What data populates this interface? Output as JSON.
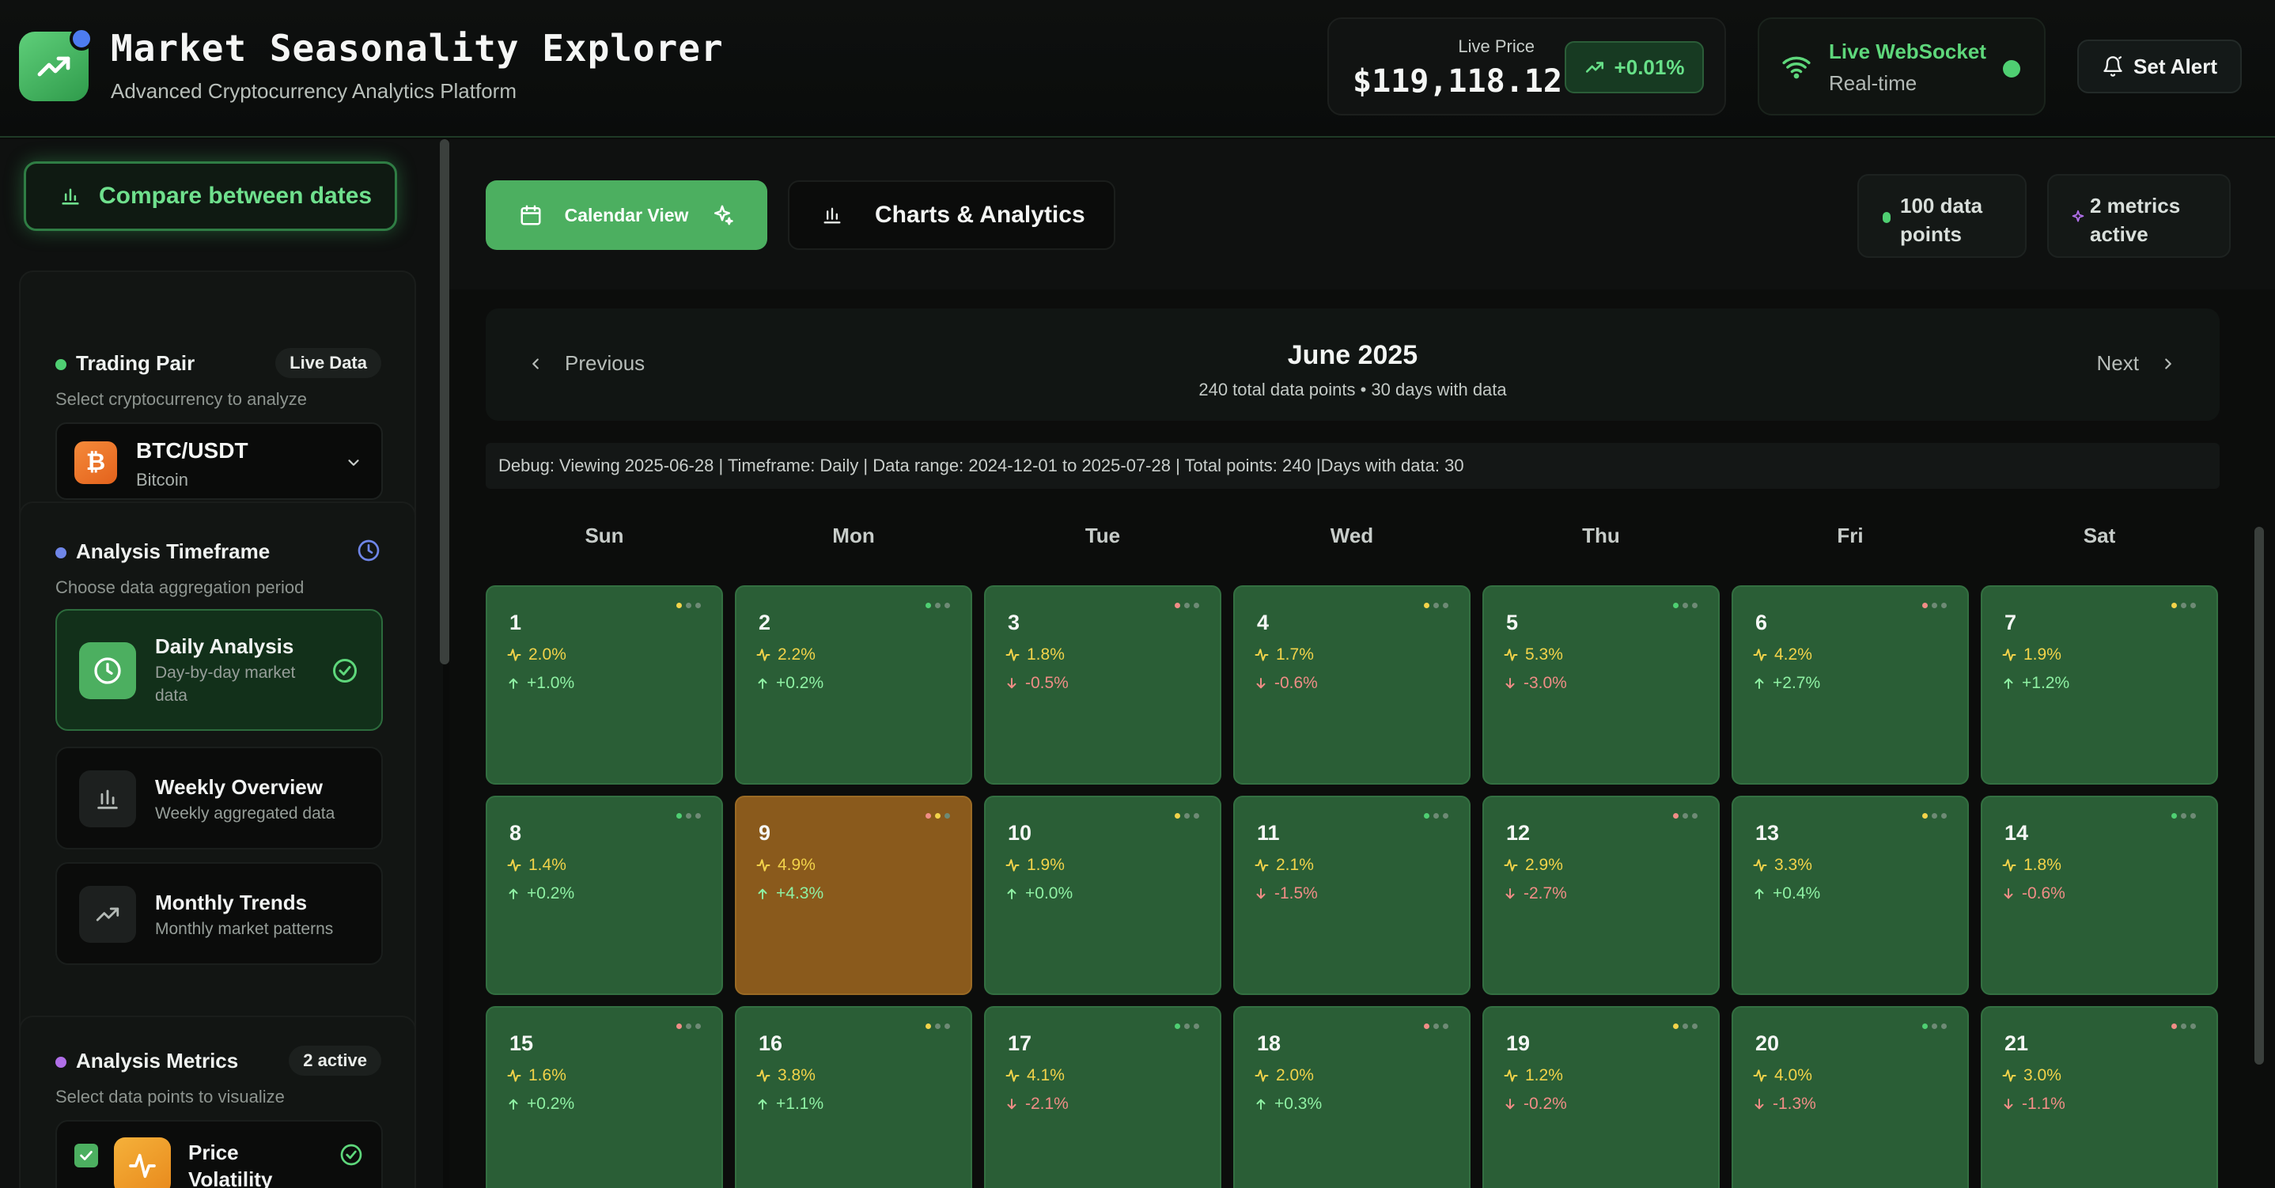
{
  "app": {
    "title": "Market Seasonality Explorer",
    "subtitle": "Advanced Cryptocurrency Analytics Platform"
  },
  "price": {
    "label": "Live Price",
    "value": "$119,118.12",
    "change": "+0.01%"
  },
  "websocket": {
    "title": "Live WebSocket",
    "subtitle": "Real-time"
  },
  "alert_button": "Set Alert",
  "sidebar": {
    "compare_button": "Compare between dates",
    "trading_pair": {
      "title": "Trading Pair",
      "badge": "Live Data",
      "description": "Select cryptocurrency to analyze",
      "selected_symbol": "BTC/USDT",
      "selected_name": "Bitcoin",
      "badge_glyph": "₿"
    },
    "timeframe": {
      "title": "Analysis Timeframe",
      "description": "Choose data aggregation period",
      "options": [
        {
          "name": "Daily Analysis",
          "desc": "Day-by-day market data"
        },
        {
          "name": "Weekly Overview",
          "desc": "Weekly aggregated data"
        },
        {
          "name": "Monthly Trends",
          "desc": "Monthly market patterns"
        }
      ]
    },
    "metrics": {
      "title": "Analysis Metrics",
      "badge": "2 active",
      "description": "Select data points to visualize",
      "first_item": "Price Volatility"
    }
  },
  "view_tabs": {
    "calendar": "Calendar View",
    "charts": "Charts & Analytics"
  },
  "stats": {
    "points": "100 data points",
    "metrics": "2 metrics active"
  },
  "month_nav": {
    "previous": "Previous",
    "next": "Next",
    "title": "June 2025",
    "subtitle": "240 total data points • 30 days with data"
  },
  "debug_text": "Debug: Viewing 2025-06-28 | Timeframe: Daily | Data range: 2024-12-01 to 2025-07-28 | Total points: 240 |Days with data: 30",
  "weekdays": [
    "Sun",
    "Mon",
    "Tue",
    "Wed",
    "Thu",
    "Fri",
    "Sat"
  ],
  "calendar_days": [
    {
      "day": "1",
      "vol": "2.0%",
      "chg": "+1.0%",
      "dir": "up"
    },
    {
      "day": "2",
      "vol": "2.2%",
      "chg": "+0.2%",
      "dir": "up"
    },
    {
      "day": "3",
      "vol": "1.8%",
      "chg": "-0.5%",
      "dir": "down"
    },
    {
      "day": "4",
      "vol": "1.7%",
      "chg": "-0.6%",
      "dir": "down"
    },
    {
      "day": "5",
      "vol": "5.3%",
      "chg": "-3.0%",
      "dir": "down"
    },
    {
      "day": "6",
      "vol": "4.2%",
      "chg": "+2.7%",
      "dir": "up"
    },
    {
      "day": "7",
      "vol": "1.9%",
      "chg": "+1.2%",
      "dir": "up"
    },
    {
      "day": "8",
      "vol": "1.4%",
      "chg": "+0.2%",
      "dir": "up"
    },
    {
      "day": "9",
      "vol": "4.9%",
      "chg": "+4.3%",
      "dir": "up",
      "hot": true
    },
    {
      "day": "10",
      "vol": "1.9%",
      "chg": "+0.0%",
      "dir": "up"
    },
    {
      "day": "11",
      "vol": "2.1%",
      "chg": "-1.5%",
      "dir": "down"
    },
    {
      "day": "12",
      "vol": "2.9%",
      "chg": "-2.7%",
      "dir": "down"
    },
    {
      "day": "13",
      "vol": "3.3%",
      "chg": "+0.4%",
      "dir": "up"
    },
    {
      "day": "14",
      "vol": "1.8%",
      "chg": "-0.6%",
      "dir": "down"
    },
    {
      "day": "15",
      "vol": "1.6%",
      "chg": "+0.2%",
      "dir": "up"
    },
    {
      "day": "16",
      "vol": "3.8%",
      "chg": "+1.1%",
      "dir": "up"
    },
    {
      "day": "17",
      "vol": "4.1%",
      "chg": "-2.1%",
      "dir": "down"
    },
    {
      "day": "18",
      "vol": "2.0%",
      "chg": "+0.3%",
      "dir": "up"
    },
    {
      "day": "19",
      "vol": "1.2%",
      "chg": "-0.2%",
      "dir": "down"
    },
    {
      "day": "20",
      "vol": "4.0%",
      "chg": "-1.3%",
      "dir": "down"
    },
    {
      "day": "21",
      "vol": "3.0%",
      "chg": "-1.1%",
      "dir": "down"
    }
  ],
  "colors": {
    "accent": "#4caf60",
    "up": "#8ef0a3",
    "down": "#f08d86",
    "volatility": "#f2d34a",
    "cell": "#2a5e36",
    "cell_hot": "#8a5a1c"
  },
  "icons": {
    "logo": "trending-up-icon",
    "ws": "wifi-icon",
    "alert": "bell-icon",
    "compare": "bar-chart-icon",
    "timeframe_badge": "clock-icon"
  }
}
